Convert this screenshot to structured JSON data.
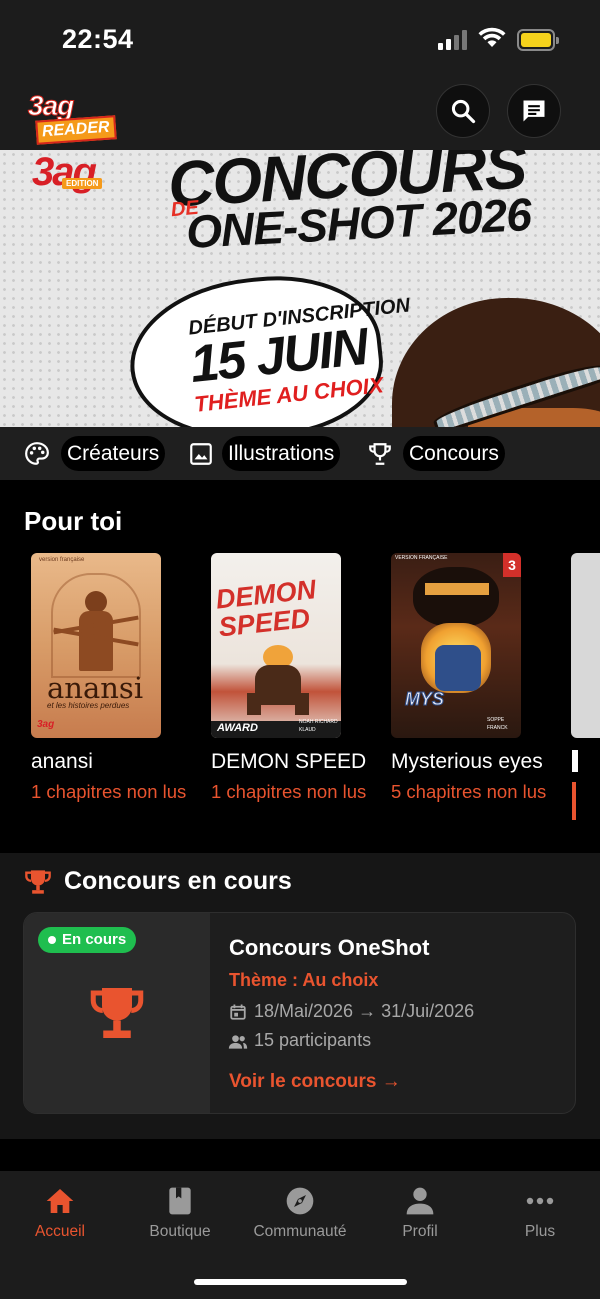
{
  "status_bar": {
    "time": "22:54"
  },
  "header": {
    "logo_top": "3ag",
    "logo_bottom": "READER",
    "search_icon": "search-icon",
    "chat_icon": "chat-icon"
  },
  "banner": {
    "logo": "3ag",
    "logo_sub": "EDITION",
    "title_line1": "CONCOURS",
    "title_de": "DE",
    "title_line2": "ONE-SHOT 2026",
    "bubble_line1": "DÉBUT D'INSCRIPTION",
    "bubble_line2": "15 JUIN",
    "bubble_line3": "THÈME AU CHOIX"
  },
  "categories": [
    {
      "label": "Créateurs",
      "icon": "palette-icon"
    },
    {
      "label": "Illustrations",
      "icon": "image-icon"
    },
    {
      "label": "Concours",
      "icon": "trophy-icon"
    }
  ],
  "for_you": {
    "title": "Pour toi",
    "items": [
      {
        "title": "anansi",
        "subtitle": "1 chapitres non lus",
        "cover_title": "anansi",
        "cover_sub": "et les histoires perdues",
        "cover_top": "version française"
      },
      {
        "title": "DEMON SPEED",
        "subtitle": "1 chapitres non lus",
        "cover_title": "DEMON SPEED",
        "cover_award": "AWARD",
        "cover_credit1": "NOAH RICHARD",
        "cover_credit2": "KLAUD"
      },
      {
        "title": "Mysterious eyes",
        "subtitle": "5 chapitres non lus",
        "cover_num": "3",
        "cover_top": "VERSION FRANÇAISE",
        "cover_credit1": "SOPPE",
        "cover_credit2": "FRANCK"
      }
    ]
  },
  "contest": {
    "section_title": "Concours en cours",
    "badge": "En cours",
    "name": "Concours OneShot",
    "theme": "Thème : Au choix",
    "dates": "18/Mai/2026 → 31/Jui/2026",
    "participants": "15 participants",
    "link": "Voir le concours →"
  },
  "bottom_nav": [
    {
      "label": "Accueil",
      "icon": "home-icon",
      "active": true
    },
    {
      "label": "Boutique",
      "icon": "book-icon",
      "active": false
    },
    {
      "label": "Communauté",
      "icon": "compass-icon",
      "active": false
    },
    {
      "label": "Profil",
      "icon": "person-icon",
      "active": false
    },
    {
      "label": "Plus",
      "icon": "more-icon",
      "active": false
    }
  ],
  "colors": {
    "accent": "#e9542f",
    "badge_green": "#1fbe4f",
    "background": "#000000"
  }
}
